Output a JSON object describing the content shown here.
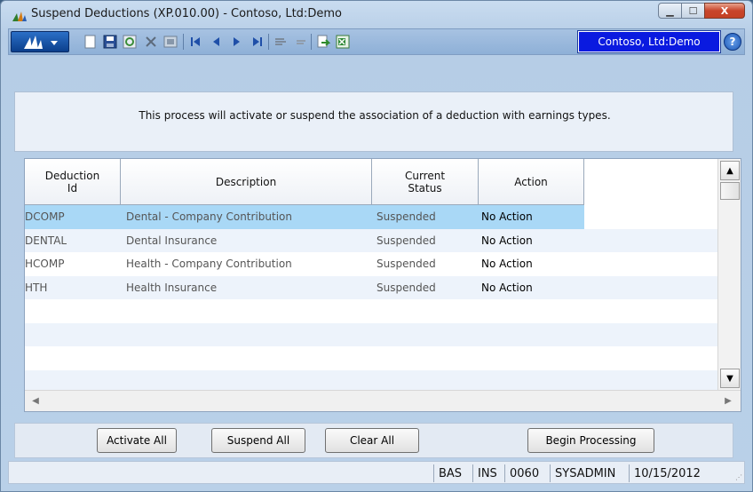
{
  "window": {
    "title": "Suspend Deductions (XP.010.00) - Contoso, Ltd:Demo",
    "controls": {
      "minimize": "▁",
      "maximize": "☐",
      "close": "X"
    }
  },
  "toolbar": {
    "logo_label": "≡▾",
    "company": "Contoso, Ltd:Demo",
    "help": "?",
    "icons": [
      "new-icon",
      "save-icon",
      "refresh-icon",
      "delete-icon",
      "cancel-icon",
      "first-icon",
      "previous-icon",
      "next-icon",
      "last-icon",
      "copy-icon",
      "paste-icon",
      "report-icon",
      "excel-icon"
    ]
  },
  "description": "This process will activate or suspend the association of a deduction with earnings types.",
  "grid": {
    "columns": [
      {
        "line1": "Deduction",
        "line2": "Id"
      },
      {
        "line1": "Description",
        "line2": ""
      },
      {
        "line1": "Current",
        "line2": "Status"
      },
      {
        "line1": "Action",
        "line2": ""
      }
    ],
    "rows": [
      {
        "id": "DCOMP",
        "description": "Dental - Company Contribution",
        "status": "Suspended",
        "action": "No Action"
      },
      {
        "id": "DENTAL",
        "description": "Dental Insurance",
        "status": "Suspended",
        "action": "No Action"
      },
      {
        "id": "HCOMP",
        "description": "Health - Company Contribution",
        "status": "Suspended",
        "action": "No Action"
      },
      {
        "id": "HTH",
        "description": "Health Insurance",
        "status": "Suspended",
        "action": "No Action"
      }
    ],
    "selected_row_color": "#a9d8f6"
  },
  "buttons": {
    "activate_all": "Activate All",
    "suspend_all": "Suspend All",
    "clear_all": "Clear All",
    "begin_processing": "Begin Processing"
  },
  "status": {
    "mode": "BAS",
    "insert": "INS",
    "code": "0060",
    "user": "SYSADMIN",
    "date": "10/15/2012"
  }
}
